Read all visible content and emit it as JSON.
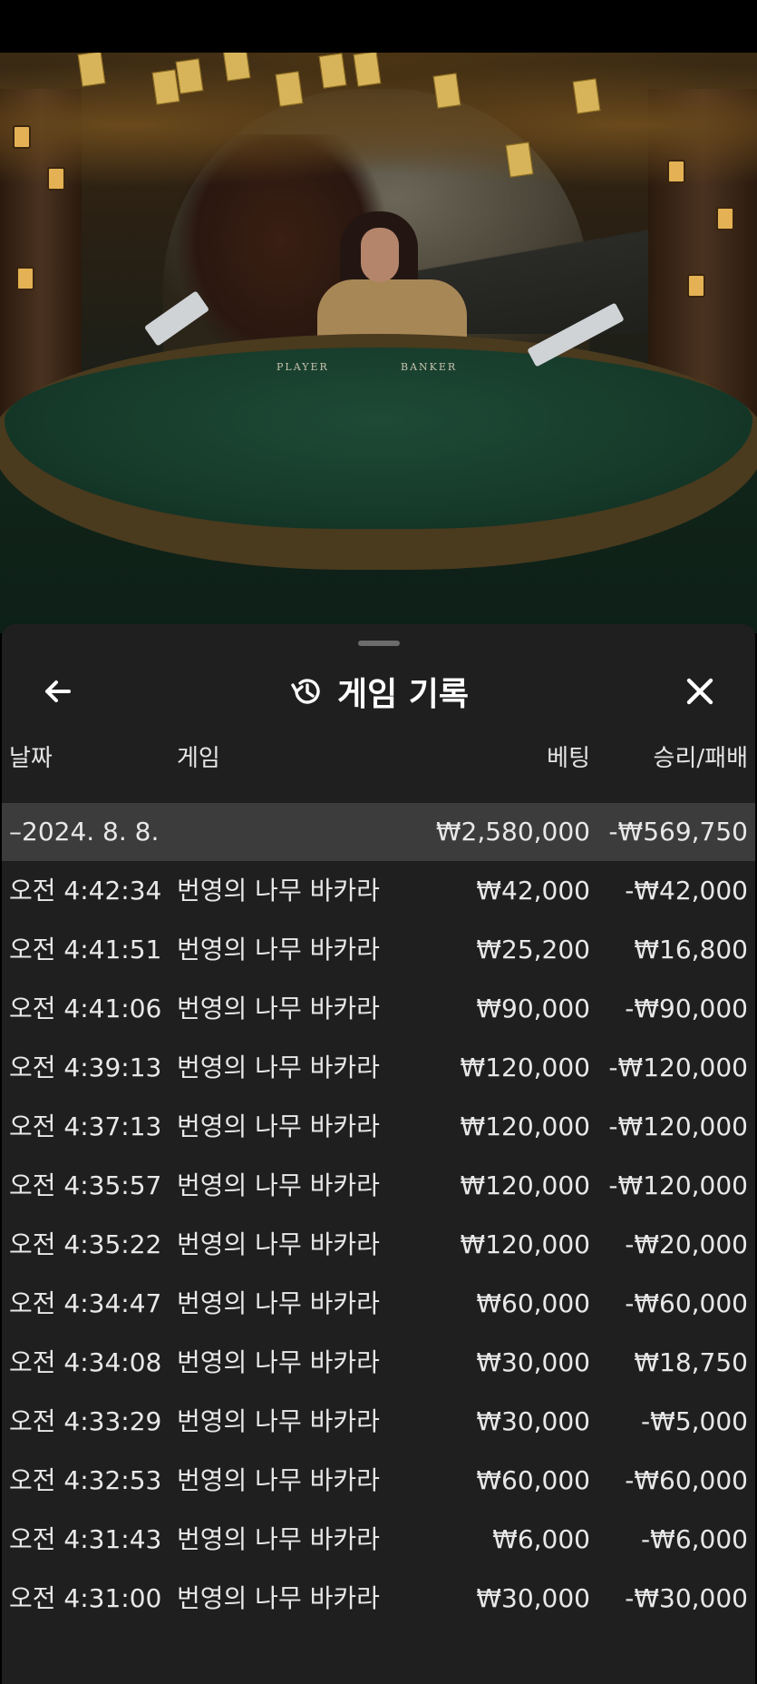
{
  "scene": {
    "table_labels": {
      "player": "PLAYER",
      "banker": "BANKER"
    }
  },
  "panel": {
    "title": "게임 기록",
    "icons": {
      "back": "arrow-left-icon",
      "history": "history-icon",
      "close": "close-icon"
    },
    "columns": {
      "date": "날짜",
      "game": "게임",
      "bet": "베팅",
      "result": "승리/패배"
    },
    "summary": {
      "date": "–2024. 8. 8.",
      "bet": "₩2,580,000",
      "result": "-₩569,750"
    },
    "rows": [
      {
        "time": "오전 4:42:34",
        "game": "번영의 나무 바카라",
        "bet": "₩42,000",
        "result": "-₩42,000"
      },
      {
        "time": "오전 4:41:51",
        "game": "번영의 나무 바카라",
        "bet": "₩25,200",
        "result": "₩16,800"
      },
      {
        "time": "오전 4:41:06",
        "game": "번영의 나무 바카라",
        "bet": "₩90,000",
        "result": "-₩90,000"
      },
      {
        "time": "오전 4:39:13",
        "game": "번영의 나무 바카라",
        "bet": "₩120,000",
        "result": "-₩120,000"
      },
      {
        "time": "오전 4:37:13",
        "game": "번영의 나무 바카라",
        "bet": "₩120,000",
        "result": "-₩120,000"
      },
      {
        "time": "오전 4:35:57",
        "game": "번영의 나무 바카라",
        "bet": "₩120,000",
        "result": "-₩120,000"
      },
      {
        "time": "오전 4:35:22",
        "game": "번영의 나무 바카라",
        "bet": "₩120,000",
        "result": "-₩20,000"
      },
      {
        "time": "오전 4:34:47",
        "game": "번영의 나무 바카라",
        "bet": "₩60,000",
        "result": "-₩60,000"
      },
      {
        "time": "오전 4:34:08",
        "game": "번영의 나무 바카라",
        "bet": "₩30,000",
        "result": "₩18,750"
      },
      {
        "time": "오전 4:33:29",
        "game": "번영의 나무 바카라",
        "bet": "₩30,000",
        "result": "-₩5,000"
      },
      {
        "time": "오전 4:32:53",
        "game": "번영의 나무 바카라",
        "bet": "₩60,000",
        "result": "-₩60,000"
      },
      {
        "time": "오전 4:31:43",
        "game": "번영의 나무 바카라",
        "bet": "₩6,000",
        "result": "-₩6,000"
      },
      {
        "time": "오전 4:31:00",
        "game": "번영의 나무 바카라",
        "bet": "₩30,000",
        "result": "-₩30,000"
      }
    ]
  }
}
